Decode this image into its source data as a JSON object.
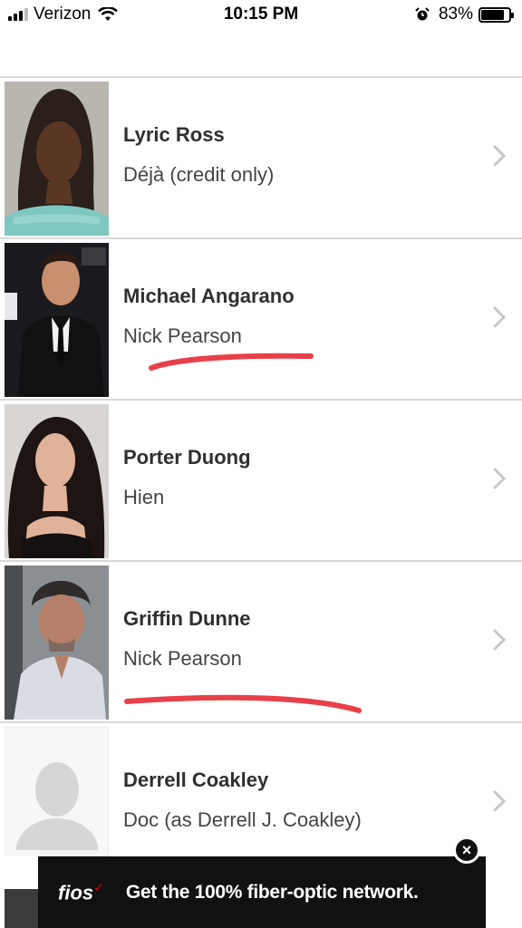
{
  "status_bar": {
    "carrier": "Verizon",
    "time": "10:15 PM",
    "battery_percent": "83%",
    "battery_level": 0.83
  },
  "cast": [
    {
      "actor": "Lyric Ross",
      "role": "Déjà (credit only)"
    },
    {
      "actor": "Michael Angarano",
      "role": "Nick Pearson"
    },
    {
      "actor": "Porter Duong",
      "role": "Hien"
    },
    {
      "actor": "Griffin Dunne",
      "role": "Nick Pearson"
    },
    {
      "actor": "Derrell Coakley",
      "role": "Doc (as Derrell J. Coakley)"
    }
  ],
  "ad": {
    "brand": "fios",
    "text": "Get the 100% fiber-optic network.",
    "close_glyph": "×"
  },
  "colors": {
    "annotation_red": "#e8404a",
    "divider": "#d8d8d8",
    "chevron": "#c7c7cc"
  },
  "icons": [
    "signal-icon",
    "wifi-icon",
    "alarm-icon",
    "battery-icon",
    "chevron-right-icon",
    "close-icon",
    "placeholder-avatar-icon"
  ]
}
